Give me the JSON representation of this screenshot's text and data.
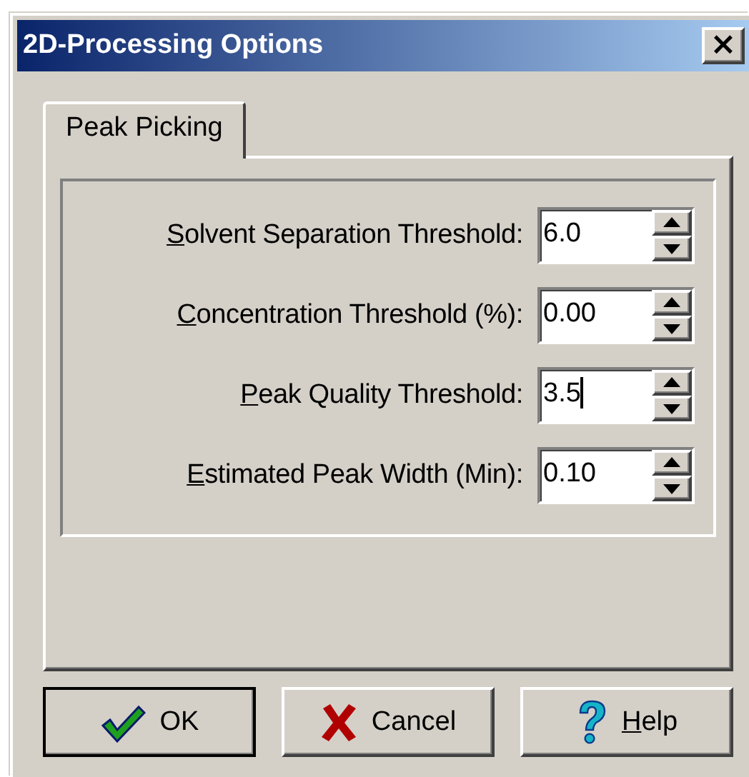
{
  "window": {
    "title": "2D-Processing Options",
    "close_label": "×"
  },
  "tabs": [
    {
      "label": "Peak Picking",
      "selected": true
    }
  ],
  "fields": [
    {
      "label": "Solvent Separation Threshold:",
      "mnemonic": true,
      "value": "6.0",
      "focused": false
    },
    {
      "label": "Concentration Threshold (%):",
      "mnemonic": true,
      "value": "0.00",
      "focused": false
    },
    {
      "label": "Peak Quality Threshold:",
      "mnemonic": true,
      "value": "3.5",
      "focused": true
    },
    {
      "label": "Estimated Peak Width (Min):",
      "mnemonic": true,
      "value": "0.10",
      "focused": false
    }
  ],
  "buttons": [
    {
      "label": "OK",
      "kind": "ok",
      "mnemonic": false,
      "default": true
    },
    {
      "label": "Cancel",
      "kind": "cancel",
      "mnemonic": false,
      "default": false
    },
    {
      "label": "Help",
      "kind": "help",
      "mnemonic": true,
      "default": false
    }
  ]
}
